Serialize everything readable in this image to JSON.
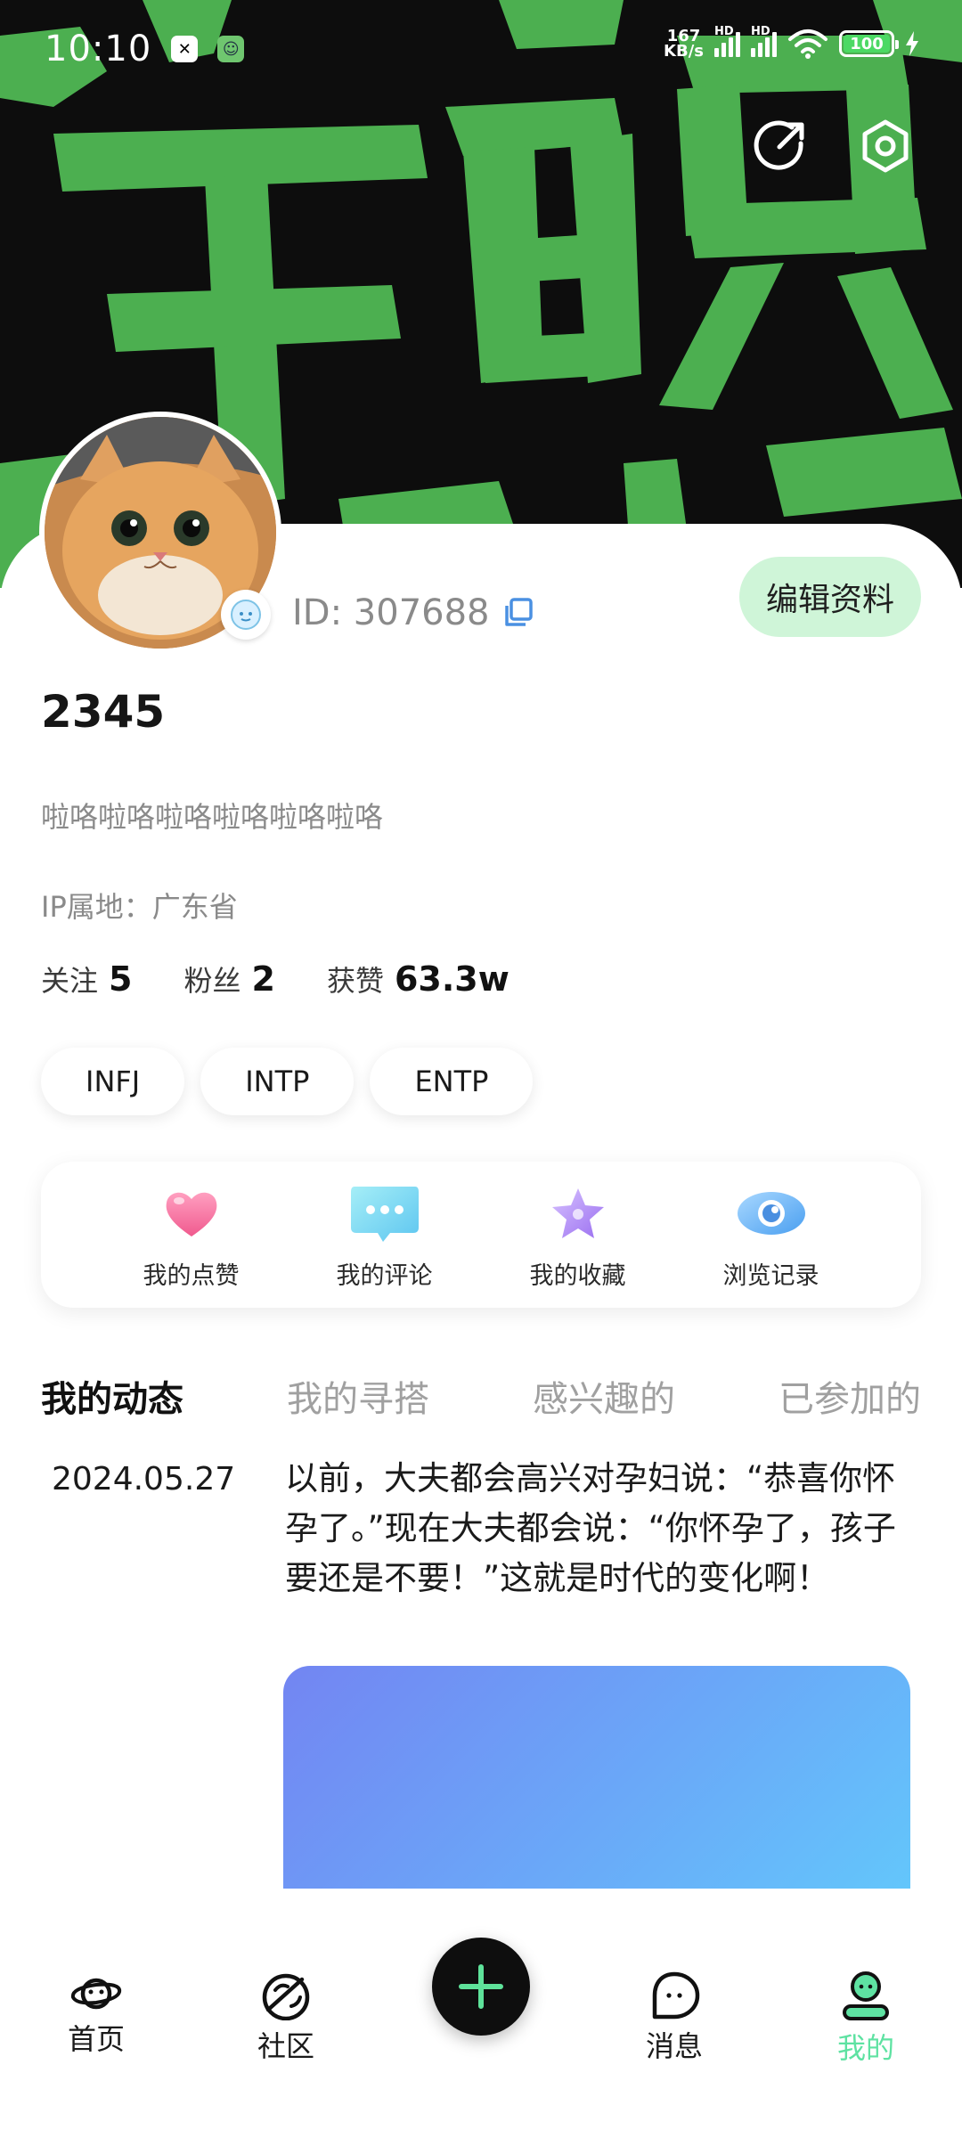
{
  "status_bar": {
    "time": "10:10",
    "net_speed_value": "167",
    "net_speed_unit": "KB/s",
    "hd_label_1": "HD",
    "hd_label_2": "HD",
    "battery": "100",
    "app_icons": [
      "capcut-icon",
      "cat-app-icon"
    ]
  },
  "header": {
    "share_icon": "share-icon",
    "settings_icon": "settings-icon"
  },
  "profile": {
    "id_text": "ID: 307688",
    "edit_button": "编辑资料",
    "nickname": "2345",
    "bio": "啦咯啦咯啦咯啦咯啦咯啦咯",
    "ip_location": "IP属地：广东省",
    "stats": [
      {
        "label": "关注",
        "value": "5"
      },
      {
        "label": "粉丝",
        "value": "2"
      },
      {
        "label": "获赞",
        "value": "63.3w"
      }
    ],
    "tags": [
      "INFJ",
      "INTP",
      "ENTP"
    ]
  },
  "quick_actions": [
    {
      "label": "我的点赞",
      "icon": "heart-icon"
    },
    {
      "label": "我的评论",
      "icon": "comment-icon"
    },
    {
      "label": "我的收藏",
      "icon": "star-icon"
    },
    {
      "label": "浏览记录",
      "icon": "eye-icon"
    }
  ],
  "tabs": [
    {
      "label": "我的动态",
      "active": true
    },
    {
      "label": "我的寻搭",
      "active": false
    },
    {
      "label": "感兴趣的",
      "active": false
    },
    {
      "label": "已参加的",
      "active": false
    }
  ],
  "post": {
    "date": "2024.05.27",
    "text": "以前，大夫都会高兴对孕妇说：“恭喜你怀孕了。”现在大夫都会说：“你怀孕了，孩子要还是不要！”这就是时代的变化啊！"
  },
  "bottom_nav": [
    {
      "label": "首页",
      "icon": "planet-icon",
      "active": false
    },
    {
      "label": "社区",
      "icon": "community-icon",
      "active": false
    },
    {
      "label": "消息",
      "icon": "message-icon",
      "active": false
    },
    {
      "label": "我的",
      "icon": "profile-icon",
      "active": true
    }
  ],
  "colors": {
    "accent_green": "#5ee29a",
    "edit_button_bg": "#cff5d8",
    "banner_bg": "#0d0d0d",
    "banner_art": "#4caf50"
  }
}
